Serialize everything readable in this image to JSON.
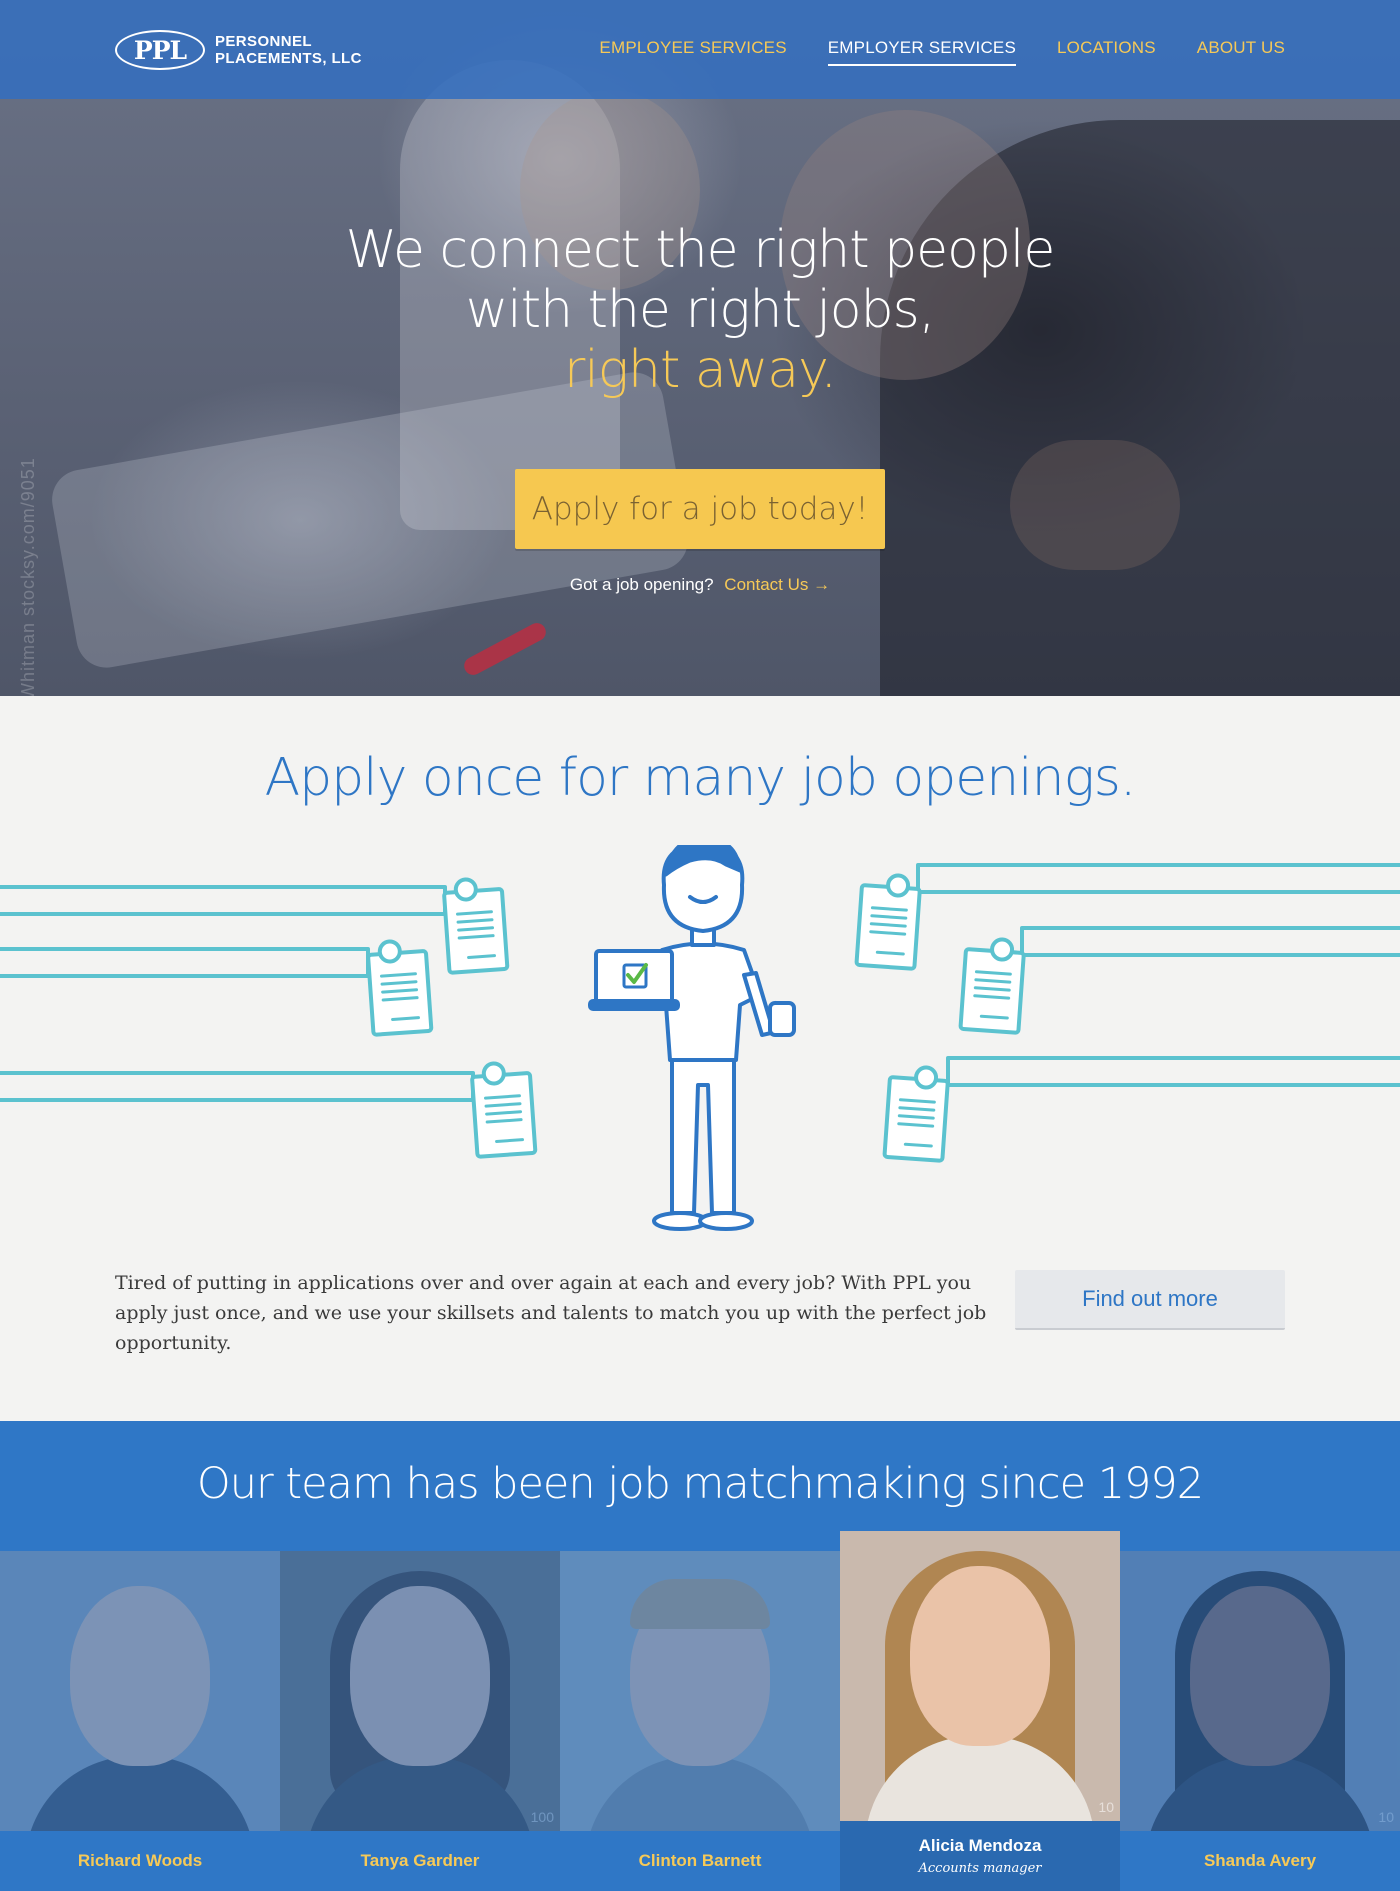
{
  "header": {
    "logo_mark": "PPL",
    "logo_line1": "PERSONNEL",
    "logo_line2": "PLACEMENTS, LLC",
    "nav": [
      {
        "label": "EMPLOYEE SERVICES",
        "active": false
      },
      {
        "label": "EMPLOYER SERVICES",
        "active": true
      },
      {
        "label": "LOCATIONS",
        "active": false
      },
      {
        "label": "ABOUT US",
        "active": false
      }
    ]
  },
  "hero": {
    "line1": "We connect the right people",
    "line2": "with the right jobs,",
    "accent": "right away.",
    "cta_label": "Apply for a job today!",
    "question": "Got a job opening?",
    "contact_link": "Contact Us →",
    "watermark": "Whitman stocksy.com/9051"
  },
  "apply": {
    "title": "Apply once for many job openings.",
    "copy": "Tired of putting in applications over and over again at each and every job? With PPL you apply just once, and we use your skillsets and talents to match you up with the perfect job opportunity.",
    "button_label": "Find out more"
  },
  "team": {
    "title": "Our team has been job matchmaking since 1992",
    "members": [
      {
        "name": "Richard Woods",
        "role": "",
        "active": false,
        "photo_num": ""
      },
      {
        "name": "Tanya Gardner",
        "role": "",
        "active": false,
        "photo_num": "100"
      },
      {
        "name": "Clinton Barnett",
        "role": "",
        "active": false,
        "photo_num": ""
      },
      {
        "name": "Alicia Mendoza",
        "role": "Accounts manager",
        "active": true,
        "photo_num": "10"
      },
      {
        "name": "Shanda Avery",
        "role": "",
        "active": false,
        "photo_num": "10"
      }
    ]
  },
  "colors": {
    "brand_blue": "#2f77c6",
    "accent_yellow": "#f6c957",
    "illustration_teal": "#5bc2cf",
    "illustration_blue": "#2e76c5",
    "check_green": "#5ab946"
  }
}
